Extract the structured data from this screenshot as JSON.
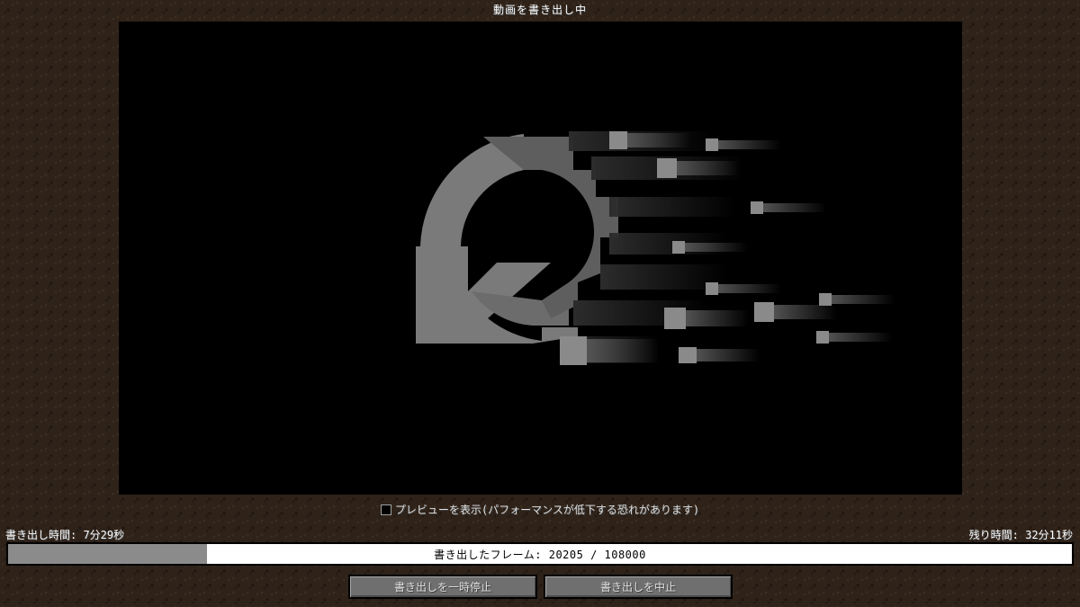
{
  "window": {
    "title": "動画を書き出し中"
  },
  "preview": {
    "checkbox_label": "プレビューを表示(パフォーマンスが低下する恐れがあります)",
    "checkbox_checked": false,
    "icon": "replay-mod-logo-icon"
  },
  "stats": {
    "elapsed_label": "書き出し時間: 7分29秒",
    "remaining_label": "残り時間: 32分11秒"
  },
  "progress": {
    "label": "書き出したフレーム: 20205 / 108000",
    "frames_done": 20205,
    "frames_total": 108000
  },
  "buttons": {
    "pause_label": "書き出しを一時停止",
    "cancel_label": "書き出しを中止"
  },
  "colors": {
    "background": "#2e2219",
    "progress_fill": "#8b8b8b",
    "progress_empty": "#ffffff",
    "button_face": "#6f6f6f"
  }
}
